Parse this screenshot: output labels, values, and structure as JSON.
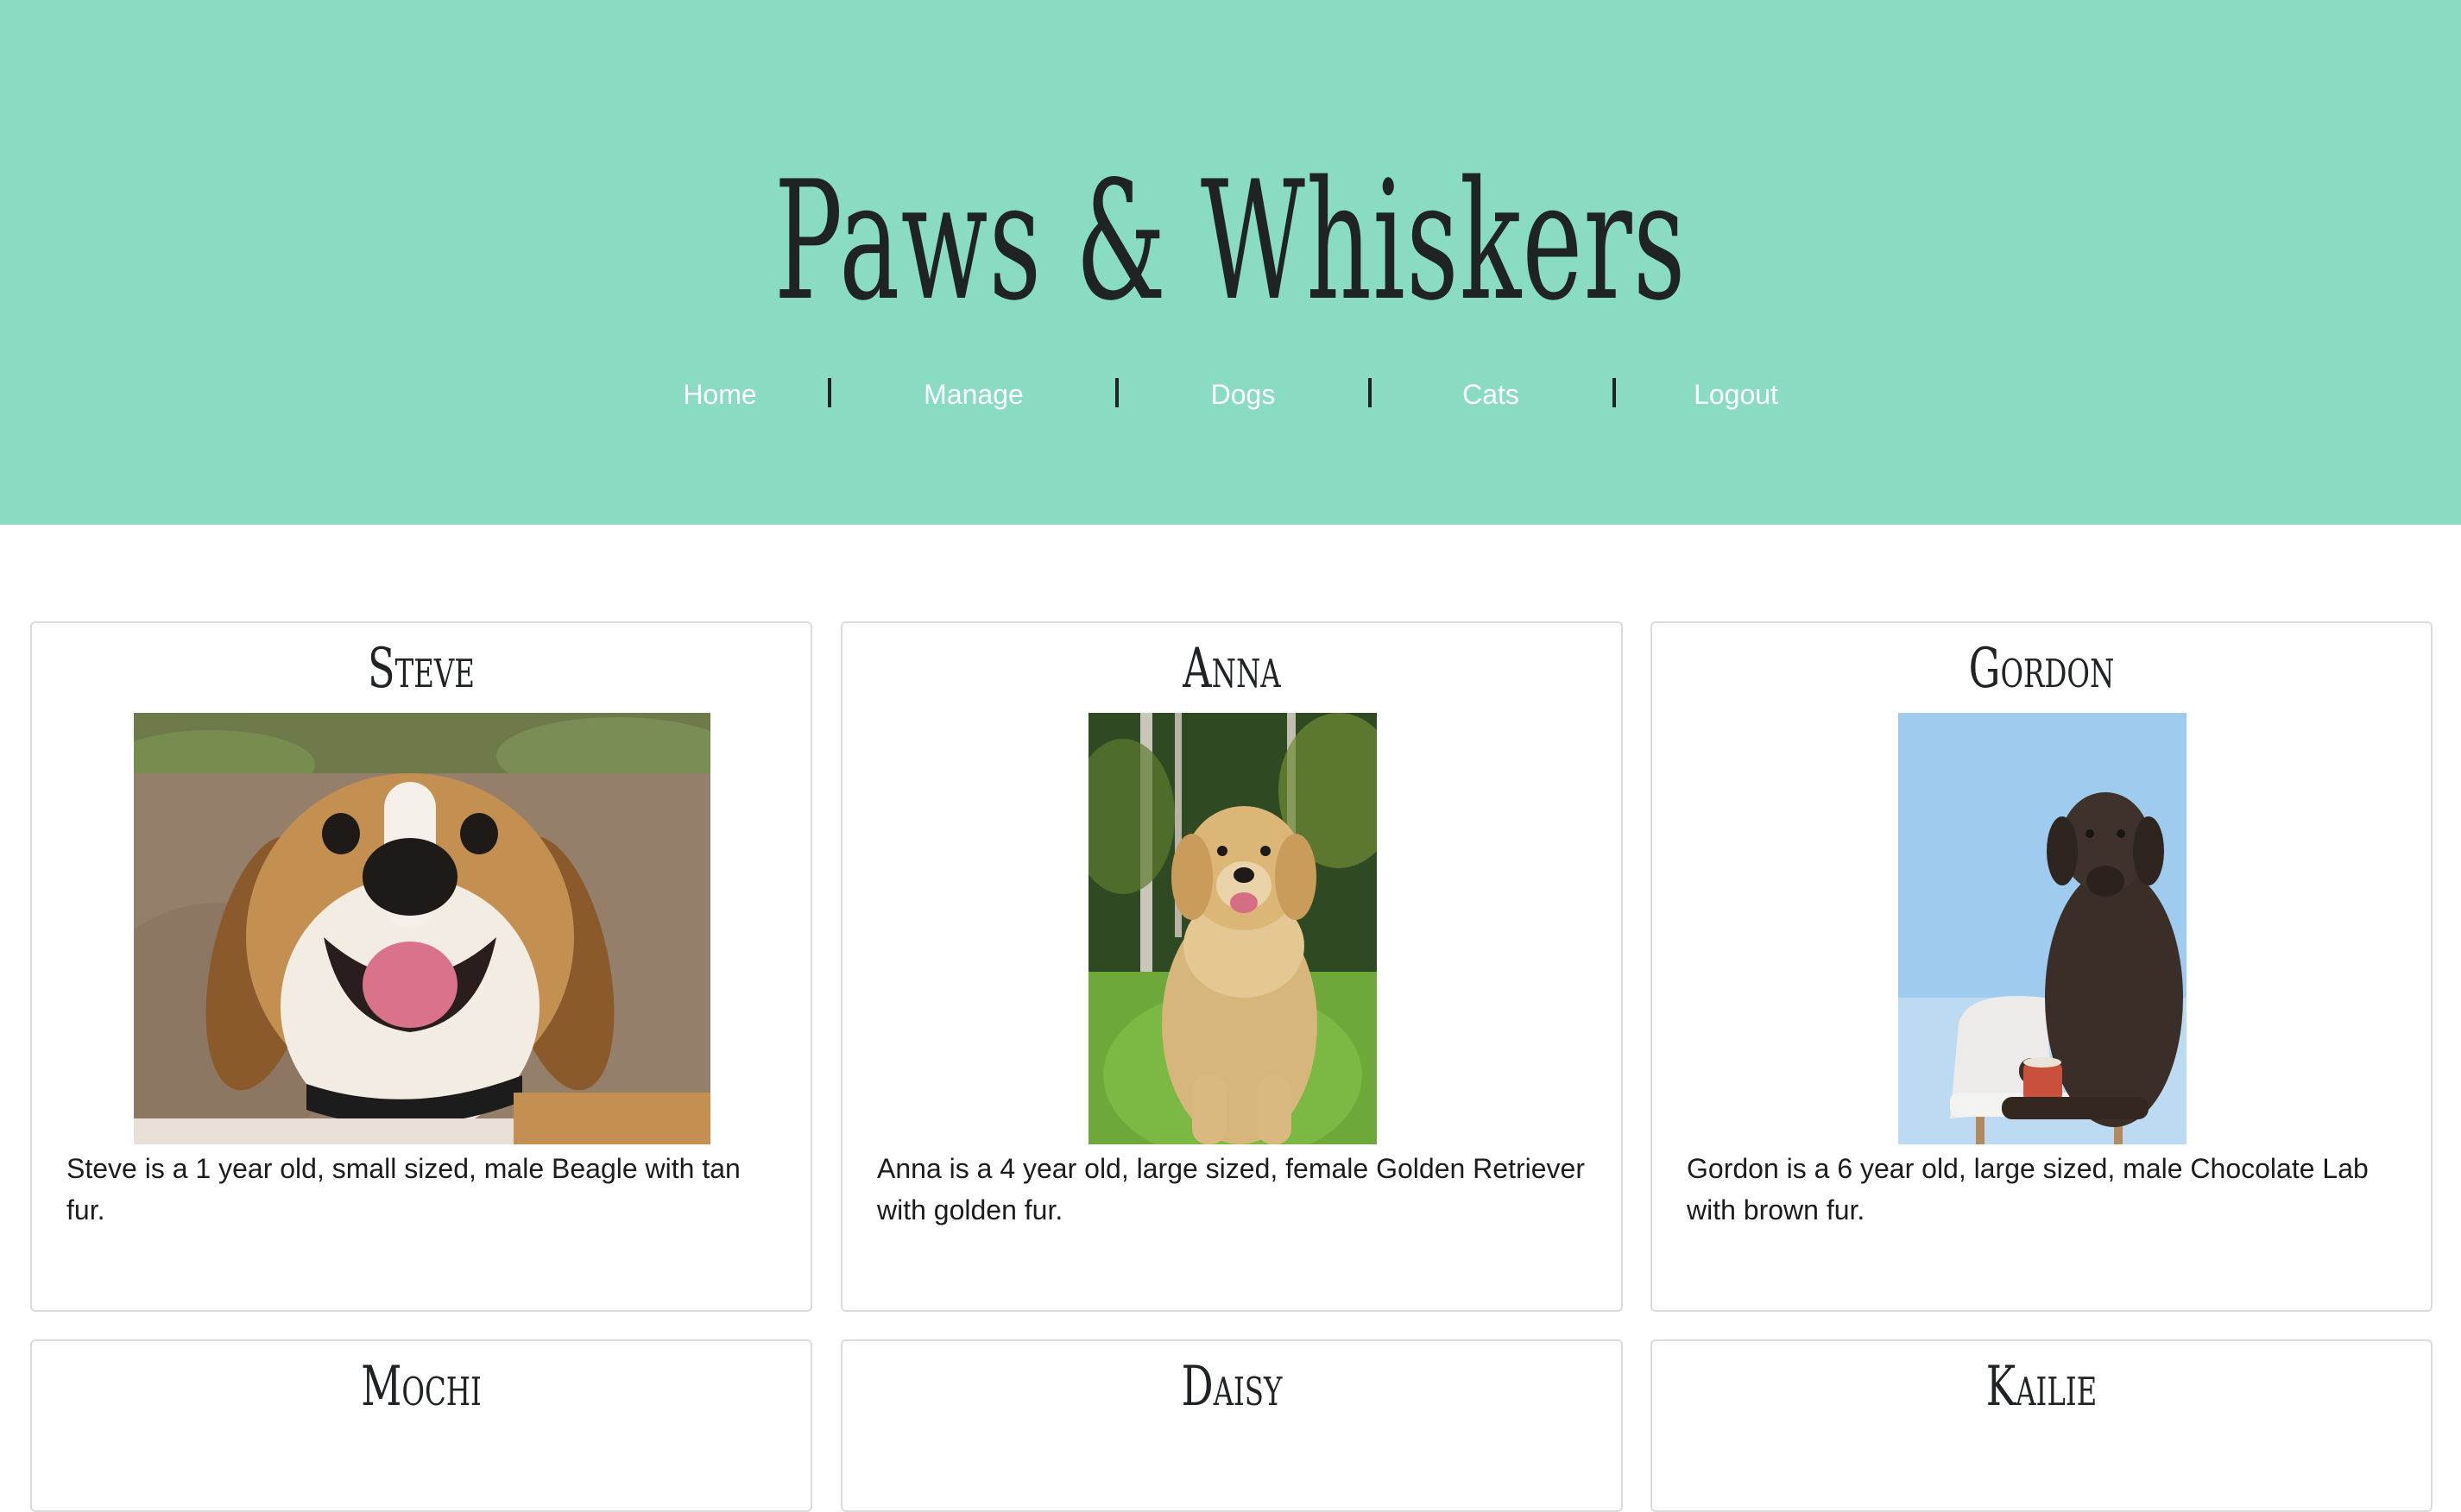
{
  "header": {
    "title": "Paws & Whiskers",
    "nav": [
      {
        "label": "Home"
      },
      {
        "label": "Manage"
      },
      {
        "label": "Dogs"
      },
      {
        "label": "Cats"
      },
      {
        "label": "Logout"
      }
    ],
    "separator": "|"
  },
  "pets": [
    {
      "name": "Steve",
      "description": "Steve is a 1 year old, small sized, male Beagle with tan fur."
    },
    {
      "name": "Anna",
      "description": "Anna is a 4 year old, large sized, female Golden Retriever with golden fur."
    },
    {
      "name": "Gordon",
      "description": "Gordon is a 6 year old, large sized, male Chocolate Lab with brown fur."
    },
    {
      "name": "Mochi"
    },
    {
      "name": "Daisy"
    },
    {
      "name": "Kailie"
    }
  ],
  "colors": {
    "header_bg": "#8adbc3",
    "title": "#1f2326",
    "nav_text": "#ffffff",
    "card_border": "#dcdcdc"
  }
}
